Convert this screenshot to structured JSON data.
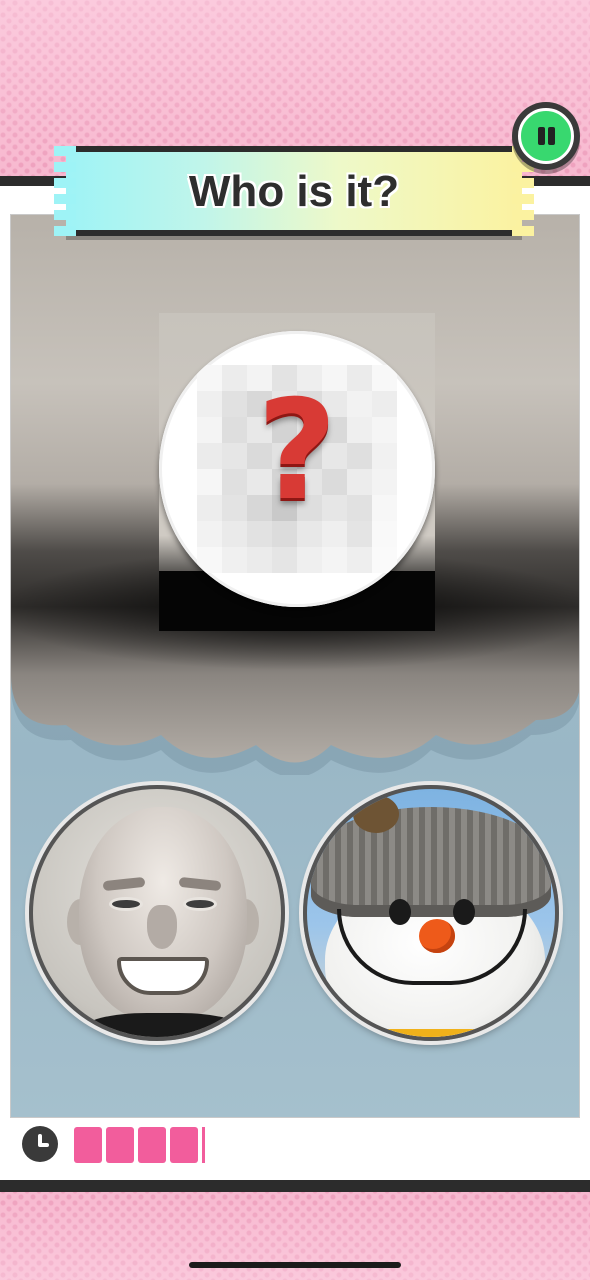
{
  "game": {
    "title": "Who is it?",
    "mystery_symbol": "?",
    "pause_icon": "pause-icon",
    "timer_icon": "clock-icon",
    "timer_remaining_fraction": 0.33,
    "choices": [
      {
        "name": "bald-man-portrait",
        "kind": "photo"
      },
      {
        "name": "snowman-portrait",
        "kind": "photo"
      }
    ]
  },
  "colors": {
    "accent_green": "#38d86f",
    "timer_pink": "#f25d9c",
    "question_red": "#d83a35",
    "banner_border": "#2c2c2c"
  }
}
